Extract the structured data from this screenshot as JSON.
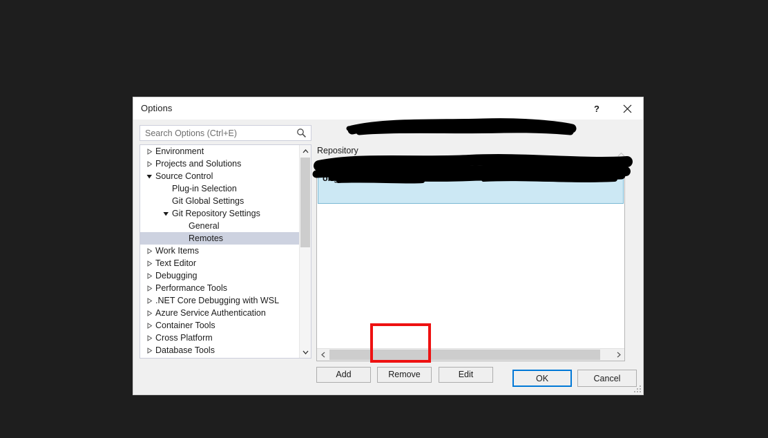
{
  "desktop": {
    "background_color": "#1e1e1e"
  },
  "dialog": {
    "title": "Options",
    "help_icon": "?",
    "close_icon": "close-icon"
  },
  "search": {
    "placeholder": "Search Options (Ctrl+E)",
    "value": "",
    "icon": "search-icon"
  },
  "tree": {
    "items": [
      {
        "label": "Environment",
        "level": 0,
        "expander": "collapsed",
        "selected": false
      },
      {
        "label": "Projects and Solutions",
        "level": 0,
        "expander": "collapsed",
        "selected": false
      },
      {
        "label": "Source Control",
        "level": 0,
        "expander": "expanded",
        "selected": false
      },
      {
        "label": "Plug-in Selection",
        "level": 1,
        "expander": "none",
        "selected": false
      },
      {
        "label": "Git Global Settings",
        "level": 1,
        "expander": "none",
        "selected": false
      },
      {
        "label": "Git Repository Settings",
        "level": 1,
        "expander": "expanded",
        "selected": false
      },
      {
        "label": "General",
        "level": 2,
        "expander": "none",
        "selected": false
      },
      {
        "label": "Remotes",
        "level": 2,
        "expander": "none",
        "selected": true
      },
      {
        "label": "Work Items",
        "level": 0,
        "expander": "collapsed",
        "selected": false
      },
      {
        "label": "Text Editor",
        "level": 0,
        "expander": "collapsed",
        "selected": false
      },
      {
        "label": "Debugging",
        "level": 0,
        "expander": "collapsed",
        "selected": false
      },
      {
        "label": "Performance Tools",
        "level": 0,
        "expander": "collapsed",
        "selected": false
      },
      {
        "label": ".NET Core Debugging with WSL",
        "level": 0,
        "expander": "collapsed",
        "selected": false
      },
      {
        "label": "Azure Service Authentication",
        "level": 0,
        "expander": "collapsed",
        "selected": false
      },
      {
        "label": "Container Tools",
        "level": 0,
        "expander": "collapsed",
        "selected": false
      },
      {
        "label": "Cross Platform",
        "level": 0,
        "expander": "collapsed",
        "selected": false
      },
      {
        "label": "Database Tools",
        "level": 0,
        "expander": "collapsed",
        "selected": false
      }
    ]
  },
  "remotes_panel": {
    "section_label": "Repository",
    "selected_remote": "origin",
    "buttons": {
      "add": "Add",
      "remove": "Remove",
      "edit": "Edit"
    }
  },
  "footer": {
    "ok": "OK",
    "cancel": "Cancel"
  },
  "annotation": {
    "target": "Remove",
    "color": "#ee1111"
  },
  "colors": {
    "selection_tree": "#cdd2e0",
    "selection_list": "#cce8f4",
    "default_button_focus": "#0078d7",
    "redaction": "#000000"
  }
}
